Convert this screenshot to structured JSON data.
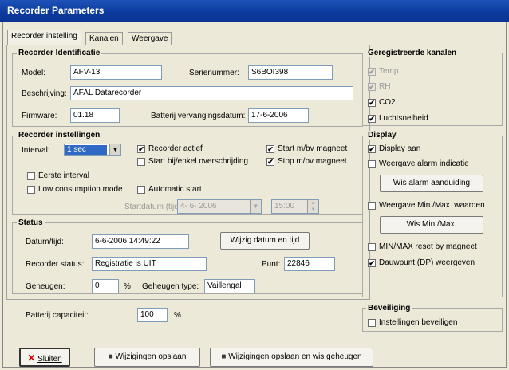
{
  "window": {
    "title": "Recorder Parameters"
  },
  "tabs": [
    "Recorder instelling",
    "Kanalen",
    "Weergave"
  ],
  "identificatie": {
    "title": "Recorder Identificatie",
    "model_label": "Model:",
    "model_value": "AFV-13",
    "serial_label": "Serienummer:",
    "serial_value": "S6BOI398",
    "description_label": "Beschrijving:",
    "description_value": "AFAL Datarecorder",
    "firmware_label": "Firmware:",
    "firmware_value": "01.18",
    "battery_label": "Batterij vervangingsdatum:",
    "battery_value": "17-6-2006"
  },
  "instellingen": {
    "title": "Recorder instellingen",
    "interval_label": "Interval:",
    "interval_value": "1 sec",
    "recorder_active": "Recorder actief",
    "start_on_exceed": "Start bij/enkel overschrijding",
    "start_magnet": "Start m/bv magneet",
    "stop_magnet": "Stop m/bv magneet",
    "first_interval": "Eerste interval",
    "low_consumption": "Low consumption mode",
    "automatic_start": "Automatic start",
    "start_date_label": "Startdatum (tijd):",
    "start_date_value": "4- 6- 2006",
    "start_time_value": "15:00"
  },
  "status": {
    "title": "Status",
    "datetime_label": "Datum/tijd:",
    "datetime_value": "6-6-2006 14:49:22",
    "write_button": "Wijzig datum en tijd",
    "recorder_status_label": "Recorder status:",
    "recorder_status_value": "Registratie is UIT",
    "point_label": "Punt:",
    "point_value": "22846",
    "memory_label": "Geheugen:",
    "memory_value": "0",
    "memory_unit": "%",
    "memory_type_label": "Geheugen type:",
    "memory_type_value": "Vaillengal",
    "battery_cap_label": "Batterij capaciteit:",
    "battery_cap_value": "100",
    "battery_cap_unit": "%"
  },
  "channels": {
    "title": "Geregistreerde kanalen",
    "items": [
      {
        "label": "Temp",
        "checked": true,
        "disabled": true
      },
      {
        "label": "RH",
        "checked": true,
        "disabled": true
      },
      {
        "label": "CO2",
        "checked": true,
        "disabled": false
      },
      {
        "label": "Luchtsnelheid",
        "checked": true,
        "disabled": false
      }
    ]
  },
  "display": {
    "title": "Display",
    "display_on": "Display aan",
    "alarm_indication": "Weergave alarm indicatie",
    "alarm_button": "Wis alarm aanduiding",
    "minmax_show": "Weergave Min./Max. waarden",
    "minmax_button": "Wis Min./Max.",
    "minmax_reset": "MIN/MAX reset by magneet",
    "dewpoint": "Dauwpunt (DP) weergeven"
  },
  "security": {
    "title": "Beveiliging",
    "protect": "Instellingen beveiligen"
  },
  "footer": {
    "close": "Sluiten",
    "save": "Wijzigingen opslaan",
    "save_memory": "Wijzigingen opslaan en wis geheugen"
  },
  "check_mark": "✔"
}
